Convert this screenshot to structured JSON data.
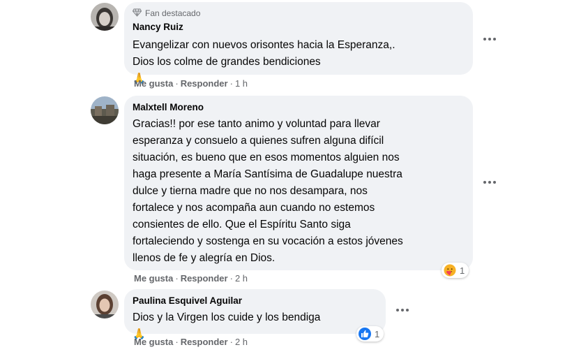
{
  "comments": [
    {
      "badge": "Fan destacado",
      "author": "Nancy Ruiz",
      "lines": [
        "Evangelizar con nuevos orisontes hacia la Esperanza,.",
        "Dios los colme de grandes bendiciones"
      ],
      "emoji": "🙏",
      "like_label": "Me gusta",
      "reply_label": "Responder",
      "time": "1 h"
    },
    {
      "author": "Malxtell Moreno",
      "lines": [
        "Gracias!! por ese tanto animo y voluntad para llevar",
        "esperanza y consuelo a quienes sufren alguna difícil",
        "situación, es bueno que en esos momentos alguien nos",
        "haga presente a María Santísima de Guadalupe nuestra",
        "dulce y tierna madre que no nos desampara, nos",
        "fortalece y nos acompaña aun cuando no estemos",
        "consientes de ello. Que el Espíritu Santo siga",
        "fortaleciendo y sostenga en su vocación a estos jóvenes",
        "llenos de fe y alegría en Dios."
      ],
      "reaction_count": "1",
      "reaction_icon": "care-reaction-icon",
      "like_label": "Me gusta",
      "reply_label": "Responder",
      "time": "2 h"
    },
    {
      "author": "Paulina Esquivel Aguilar",
      "lines": [
        "Dios y la Virgen los cuide y los bendiga"
      ],
      "emoji": "🙏",
      "reaction_count": "1",
      "reaction_icon": "like-reaction-icon",
      "like_label": "Me gusta",
      "reply_label": "Responder",
      "time": "2 h"
    }
  ],
  "colors": {
    "bubble": "#f0f2f5",
    "secondary_text": "#65676b",
    "like_blue": "#1877f2"
  }
}
